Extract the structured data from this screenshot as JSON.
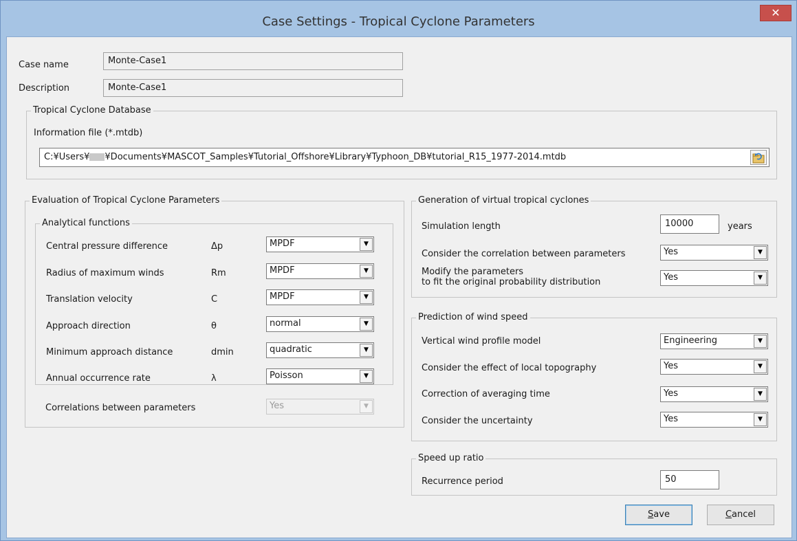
{
  "window": {
    "title": "Case Settings - Tropical Cyclone Parameters",
    "close_glyph": "✕"
  },
  "case": {
    "name_label": "Case name",
    "name_value": "Monte-Case1",
    "desc_label": "Description",
    "desc_value": "Monte-Case1"
  },
  "database": {
    "legend": "Tropical Cyclone Database",
    "file_label": "Information file (*.mtdb)",
    "path_prefix": "C:¥Users¥",
    "path_suffix": "¥Documents¥MASCOT_Samples¥Tutorial_Offshore¥Library¥Typhoon_DB¥tutorial_R15_1977-2014.mtdb"
  },
  "evaluation": {
    "legend": "Evaluation of Tropical Cyclone Parameters",
    "analytical_legend": "Analytical functions",
    "rows": [
      {
        "label": "Central pressure difference",
        "symbol": "Δp",
        "value": "MPDF"
      },
      {
        "label": "Radius of maximum winds",
        "symbol": "Rm",
        "value": "MPDF"
      },
      {
        "label": "Translation velocity",
        "symbol": "C",
        "value": "MPDF"
      },
      {
        "label": "Approach direction",
        "symbol": "θ",
        "value": "normal"
      },
      {
        "label": "Minimum approach distance",
        "symbol": "dmin",
        "value": "quadratic"
      },
      {
        "label": "Annual occurrence rate",
        "symbol": "λ",
        "value": "Poisson"
      }
    ],
    "correlations_label": "Correlations between parameters",
    "correlations_value": "Yes"
  },
  "generation": {
    "legend": "Generation of virtual tropical cyclones",
    "sim_length_label": "Simulation length",
    "sim_length_value": "10000",
    "sim_length_unit": "years",
    "correlation_label": "Consider the correlation between parameters",
    "correlation_value": "Yes",
    "modify_label_1": "Modify the parameters",
    "modify_label_2": "to fit the original probability distribution",
    "modify_value": "Yes"
  },
  "prediction": {
    "legend": "Prediction of wind speed",
    "rows": [
      {
        "label": "Vertical wind profile model",
        "value": "Engineering"
      },
      {
        "label": "Consider the effect of local topography",
        "value": "Yes"
      },
      {
        "label": "Correction of averaging time",
        "value": "Yes"
      },
      {
        "label": "Consider the uncertainty",
        "value": "Yes"
      }
    ]
  },
  "speedup": {
    "legend": "Speed up ratio",
    "recurrence_label": "Recurrence period",
    "recurrence_value": "50"
  },
  "buttons": {
    "save_mnemonic": "S",
    "save_rest": "ave",
    "cancel_mnemonic": "C",
    "cancel_rest": "ancel"
  },
  "icons": {
    "dropdown": "chevron-down-icon",
    "browse": "folder-refresh-icon",
    "close": "close-icon"
  },
  "colors": {
    "titlebar": "#a6c4e4",
    "close_button": "#c7504c",
    "client": "#f0f0f0"
  }
}
